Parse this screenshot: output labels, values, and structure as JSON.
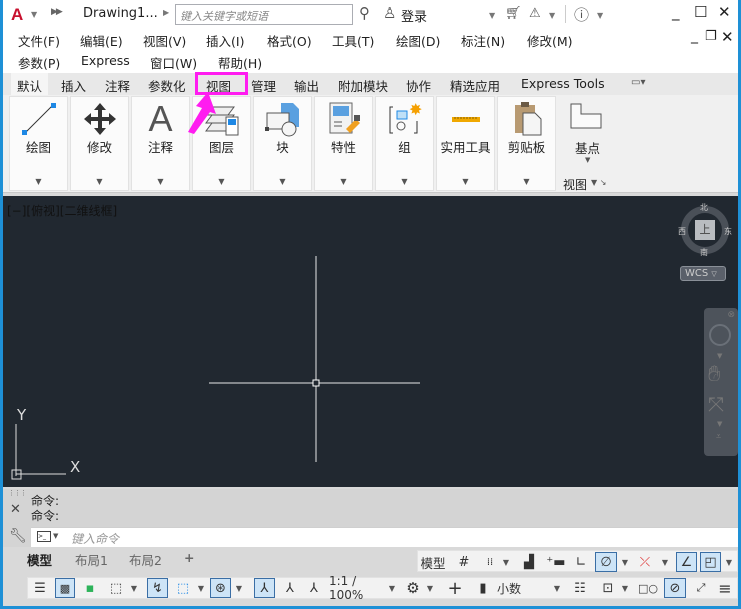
{
  "titlebar": {
    "app_logo": "A",
    "document": "Drawing1...",
    "search_placeholder": "键入关键字或短语",
    "login": "登录",
    "icons": [
      "autocad-logo-icon",
      "quick-access-icon",
      "search-icon",
      "user-icon",
      "cart-icon",
      "a360-icon",
      "help-icon",
      "minimize-icon",
      "maximize-icon",
      "close-icon"
    ]
  },
  "menubar": {
    "row1": [
      "文件(F)",
      "编辑(E)",
      "视图(V)",
      "插入(I)",
      "格式(O)",
      "工具(T)",
      "绘图(D)",
      "标注(N)",
      "修改(M)"
    ],
    "row2": [
      "参数(P)",
      "Express",
      "窗口(W)",
      "帮助(H)"
    ]
  },
  "ribbon_tabs": [
    "默认",
    "插入",
    "注释",
    "参数化",
    "视图",
    "管理",
    "输出",
    "附加模块",
    "协作",
    "精选应用",
    "Express Tools"
  ],
  "active_tab": "默认",
  "highlighted_tab": "视图",
  "highlight_color": "#ff1cf0",
  "ribbon_panels": [
    "绘图",
    "修改",
    "注释",
    "图层",
    "块",
    "特性",
    "组",
    "实用工具",
    "剪贴板"
  ],
  "base_panel": {
    "label": "基点",
    "footer": "视图"
  },
  "viewport": {
    "label": "[−][俯视][二维线框]",
    "background": "#212830",
    "viewcube": {
      "top": "上",
      "north": "北",
      "south": "南",
      "east": "东",
      "west": "西"
    },
    "wcs": "WCS",
    "ucs": {
      "x": "X",
      "y": "Y"
    }
  },
  "command": {
    "history": [
      "命令:",
      "命令:"
    ],
    "placeholder": "键入命令"
  },
  "layout_tabs": [
    "模型",
    "布局1",
    "布局2",
    "+"
  ],
  "status": {
    "model": "模型",
    "scale": "1:1 / 100%",
    "units": "小数"
  }
}
